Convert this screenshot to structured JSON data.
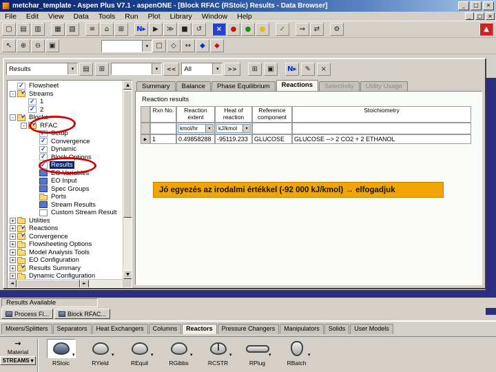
{
  "window": {
    "title": "metchar_template - Aspen Plus V7.1 - aspenONE - [Block RFAC (RStoic) Results - Data Browser]",
    "controls": {
      "minimize": "_",
      "restore": "□",
      "close": "×"
    }
  },
  "menu": {
    "items": [
      {
        "label": "File",
        "name": "menu-file"
      },
      {
        "label": "Edit",
        "name": "menu-edit"
      },
      {
        "label": "View",
        "name": "menu-view"
      },
      {
        "label": "Data",
        "name": "menu-data"
      },
      {
        "label": "Tools",
        "name": "menu-tools"
      },
      {
        "label": "Run",
        "name": "menu-run"
      },
      {
        "label": "Plot",
        "name": "menu-plot"
      },
      {
        "label": "Library",
        "name": "menu-library"
      },
      {
        "label": "Window",
        "name": "menu-window"
      },
      {
        "label": "Help",
        "name": "menu-help"
      }
    ]
  },
  "toolbars": {
    "main": [
      {
        "name": "new-button",
        "g": "▢"
      },
      {
        "name": "open-button",
        "g": "▤"
      },
      {
        "name": "save-button",
        "g": "▥"
      },
      {
        "name": "print-button",
        "g": "▦",
        "cls": "gap"
      },
      {
        "name": "print-preview-button",
        "g": "▧"
      },
      {
        "name": "data-browser-button",
        "g": "≡",
        "cls": "gap"
      },
      {
        "name": "flowsheet-button",
        "g": "⌂"
      },
      {
        "name": "grid-button",
        "g": "⊞"
      },
      {
        "name": "next-input-button",
        "g": "N▸",
        "cls": "gap blue bold"
      },
      {
        "name": "run-button",
        "g": "▶"
      },
      {
        "name": "step-button",
        "g": "≫"
      },
      {
        "name": "stop-button",
        "g": "■"
      },
      {
        "name": "reinitialize-button",
        "g": "↺"
      },
      {
        "name": "control-panel-button",
        "g": "×",
        "cls": "gap bluebox"
      },
      {
        "name": "status-red-icon",
        "g": "●",
        "cls": "red"
      },
      {
        "name": "status-green-icon",
        "g": "●",
        "cls": "green"
      },
      {
        "name": "status-yellow-icon",
        "g": "●",
        "cls": "yellow"
      },
      {
        "name": "check-results-button",
        "g": "✓",
        "cls": "gap green bold"
      },
      {
        "name": "export-button",
        "g": "⇒",
        "cls": "gap"
      },
      {
        "name": "exchange-button",
        "g": "⇄"
      },
      {
        "name": "settings-button",
        "g": "⚙",
        "cls": "gap"
      },
      {
        "name": "aspentech-logo",
        "g": "▲",
        "cls": "redbox right"
      }
    ],
    "secondary_left": [
      {
        "name": "select-pointer-button",
        "g": "↖"
      },
      {
        "name": "zoom-in-button",
        "g": "⊕"
      },
      {
        "name": "zoom-out-button",
        "g": "⊖"
      },
      {
        "name": "zoom-fit-button",
        "g": "▣"
      }
    ],
    "section_combo_value": "",
    "secondary_right": [
      {
        "name": "insert-block-button",
        "g": "□"
      },
      {
        "name": "insert-stream-button",
        "g": "◇"
      },
      {
        "name": "reroute-stream-button",
        "g": "↔"
      },
      {
        "name": "section-blue-button",
        "g": "◆",
        "cls": "blue"
      },
      {
        "name": "section-red-button",
        "g": "◆",
        "cls": "red"
      }
    ]
  },
  "browser": {
    "nav_combo_value": "Results",
    "secondary_combo_value": "",
    "prev_label": "<<",
    "filter_combo_value": "All",
    "next_label": ">>",
    "tabs": [
      {
        "label": "Summary",
        "name": "tab-summary",
        "cls": ""
      },
      {
        "label": "Balance",
        "name": "tab-balance",
        "cls": ""
      },
      {
        "label": "Phase Equilibrium",
        "name": "tab-phase-equilibrium",
        "cls": ""
      },
      {
        "label": "Reactions",
        "name": "tab-reactions",
        "cls": "active"
      },
      {
        "label": "Selectivity",
        "name": "tab-selectivity",
        "cls": "dis"
      },
      {
        "label": "Utility Usage",
        "name": "tab-utility-usage",
        "cls": "dis"
      }
    ],
    "tree": [
      {
        "label": "Flowsheet",
        "name": "tree-item-flowsheet",
        "ind": 2,
        "icon": "check",
        "tgl": ""
      },
      {
        "label": "Streams",
        "name": "tree-item-streams",
        "ind": 2,
        "icon": "folder-check",
        "tgl": "-"
      },
      {
        "label": "1",
        "name": "tree-item-stream-1",
        "ind": 18,
        "icon": "check",
        "tgl": ""
      },
      {
        "label": "2",
        "name": "tree-item-stream-2",
        "ind": 18,
        "icon": "check",
        "tgl": ""
      },
      {
        "label": "Blocks",
        "name": "tree-item-blocks",
        "ind": 2,
        "icon": "folder-check",
        "tgl": "-"
      },
      {
        "label": "RFAC",
        "name": "tree-item-rfac",
        "ind": 18,
        "icon": "folder-check",
        "tgl": "-"
      },
      {
        "label": "Setup",
        "name": "tree-item-setup",
        "ind": 34,
        "icon": "check",
        "tgl": ""
      },
      {
        "label": "Convergence",
        "name": "tree-item-convergence-block",
        "ind": 34,
        "icon": "check",
        "tgl": ""
      },
      {
        "label": "Dynamic",
        "name": "tree-item-dynamic",
        "ind": 34,
        "icon": "check",
        "tgl": ""
      },
      {
        "label": "Block Options",
        "name": "tree-item-block-options",
        "ind": 34,
        "icon": "check",
        "tgl": ""
      },
      {
        "label": "Results",
        "name": "tree-item-results",
        "ind": 34,
        "icon": "check",
        "tgl": "",
        "cls": "sel"
      },
      {
        "label": "EO Variables",
        "name": "tree-item-eo-variables",
        "ind": 34,
        "icon": "blue",
        "tgl": ""
      },
      {
        "label": "EO Input",
        "name": "tree-item-eo-input",
        "ind": 34,
        "icon": "blue",
        "tgl": ""
      },
      {
        "label": "Spec Groups",
        "name": "tree-item-spec-groups",
        "ind": 34,
        "icon": "blue",
        "tgl": ""
      },
      {
        "label": "Ports",
        "name": "tree-item-ports",
        "ind": 34,
        "icon": "folder",
        "tgl": ""
      },
      {
        "label": "Stream Results",
        "name": "tree-item-stream-results",
        "ind": 34,
        "icon": "blue",
        "tgl": ""
      },
      {
        "label": "Custom Stream Result",
        "name": "tree-item-custom-stream-result",
        "ind": 34,
        "icon": "sheet",
        "tgl": ""
      },
      {
        "label": "Utilities",
        "name": "tree-item-utilities",
        "ind": 2,
        "icon": "folder",
        "tgl": "+"
      },
      {
        "label": "Reactions",
        "name": "tree-item-reactions",
        "ind": 2,
        "icon": "folder-check",
        "tgl": "+"
      },
      {
        "label": "Convergence",
        "name": "tree-item-convergence",
        "ind": 2,
        "icon": "folder-check",
        "tgl": "+"
      },
      {
        "label": "Flowsheeting Options",
        "name": "tree-item-flowsheeting-options",
        "ind": 2,
        "icon": "folder",
        "tgl": "+"
      },
      {
        "label": "Model Analysis Tools",
        "name": "tree-item-model-analysis-tools",
        "ind": 2,
        "icon": "folder",
        "tgl": "+"
      },
      {
        "label": "EO Configuration",
        "name": "tree-item-eo-configuration",
        "ind": 2,
        "icon": "folder",
        "tgl": "+"
      },
      {
        "label": "Results Summary",
        "name": "tree-item-results-summary",
        "ind": 2,
        "icon": "folder-check",
        "tgl": "+"
      },
      {
        "label": "Dynamic Configuration",
        "name": "tree-item-dynamic-configuration",
        "ind": 2,
        "icon": "folder",
        "tgl": "+"
      }
    ],
    "group_title": "Reaction results",
    "grid": {
      "headers": [
        "Rxn No.",
        "Reaction extent",
        "Heat of reaction",
        "Reference component",
        "Stoichiometry"
      ],
      "units": {
        "extent": "kmol/hr",
        "heat": "kJ/kmol"
      },
      "row": {
        "rxn_no": "1",
        "extent": "0.49858288",
        "heat": "-95119.233",
        "ref_component": "GLUCOSE",
        "stoichiometry": "GLUCOSE --> 2 CO2 + 2 ETHANOL"
      }
    }
  },
  "annotation": {
    "text": "Jó egyezés az irodalmi értékkel (-92 000 kJ/kmol) → elfogadjuk",
    "bg": "#F0A500",
    "circle_color": "#D40000"
  },
  "status": {
    "text": "Results Available"
  },
  "window_tabs": [
    {
      "label": "Process Fl...",
      "name": "window-tab-process-flowsheet"
    },
    {
      "label": "Block RFAC...",
      "name": "window-tab-block-rfac"
    }
  ],
  "library": {
    "tabs": [
      {
        "label": "Mixers/Splitters",
        "name": "library-tab-mixers-splitters",
        "cls": ""
      },
      {
        "label": "Separators",
        "name": "library-tab-separators",
        "cls": ""
      },
      {
        "label": "Heat Exchangers",
        "name": "library-tab-heat-exchangers",
        "cls": ""
      },
      {
        "label": "Columns",
        "name": "library-tab-columns",
        "cls": ""
      },
      {
        "label": "Reactors",
        "name": "library-tab-reactors",
        "cls": "active"
      },
      {
        "label": "Pressure Changers",
        "name": "library-tab-pressure-changers",
        "cls": ""
      },
      {
        "label": "Manipulators",
        "name": "library-tab-manipulators",
        "cls": ""
      },
      {
        "label": "Solids",
        "name": "library-tab-solids",
        "cls": ""
      },
      {
        "label": "User Models",
        "name": "library-tab-user-models",
        "cls": ""
      }
    ],
    "stream_selector": {
      "category": "Material",
      "button": "STREAMS"
    },
    "models": [
      {
        "label": "RStoic",
        "name": "model-rstoic-button",
        "icon": "vessel",
        "cls": "selected"
      },
      {
        "label": "RYield",
        "name": "model-ryield-button",
        "icon": "vessel"
      },
      {
        "label": "REquil",
        "name": "model-requil-button",
        "icon": "vessel"
      },
      {
        "label": "RGibbs",
        "name": "model-rgibbs-button",
        "icon": "vessel"
      },
      {
        "label": "RCSTR",
        "name": "model-rcstr-button",
        "icon": "cstr"
      },
      {
        "label": "RPlug",
        "name": "model-rplug-button",
        "icon": "plug"
      },
      {
        "label": "RBatch",
        "name": "model-rbatch-button",
        "icon": "batch"
      }
    ]
  },
  "icons": {
    "dropdown": "▾",
    "row_marker": "▶",
    "scroll_up": "▲",
    "scroll_down": "▼",
    "scroll_left": "◄",
    "scroll_right": "►",
    "sheet_view": "▤",
    "tree_view": "⊞",
    "table_view": "⊞",
    "plot_view": "▣",
    "next_input": "N▸",
    "edit_pencil": "✎",
    "close_form": "×",
    "stream_arrow": "→"
  }
}
